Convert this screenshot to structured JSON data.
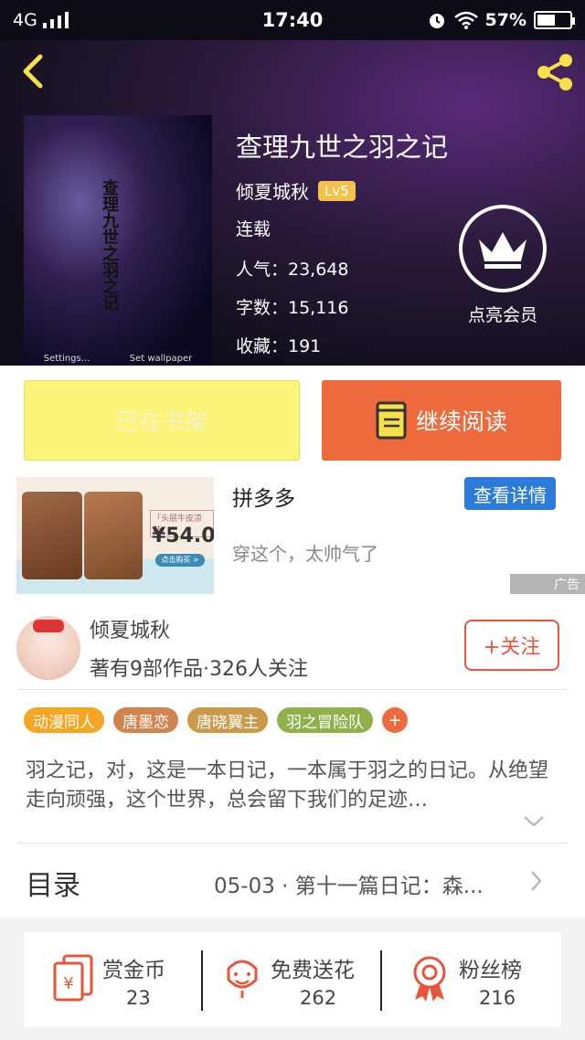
{
  "status_bar": {
    "network": "4G",
    "time": "17:40",
    "battery": "57%",
    "battery_level": 0.57
  },
  "book": {
    "title": "查理九世之羽之记",
    "author": "倾夏城秋",
    "level": "Lv5",
    "status": "连载",
    "popularity": "人气：23,648",
    "words": "字数：15,116",
    "favorites": "收藏：191",
    "cover": {
      "title_text": "查理九世之羽之记",
      "footer_left": "Settings...",
      "footer_right": "Set wallpaper"
    }
  },
  "vip": {
    "label": "点亮会员"
  },
  "actions": {
    "shelf_label": "已在书架",
    "read_label": "继续阅读"
  },
  "ad": {
    "title": "拼多多",
    "subtitle": "穿这个，太帅气了",
    "detail_label": "查看详情",
    "image_tag": "「头层牛皮凉鞋」",
    "image_price": "¥54.0",
    "image_buy": "点击购买 >",
    "mark": "广告"
  },
  "author_card": {
    "name": "倾夏城秋",
    "stats": "著有9部作品·326人关注",
    "follow_label": "+关注",
    "tags": [
      {
        "label": "动漫同人",
        "color": "#f5a623"
      },
      {
        "label": "唐墨恋",
        "color": "#d2844f"
      },
      {
        "label": "唐晓翼主",
        "color": "#c89a4a"
      },
      {
        "label": "羽之冒险队",
        "color": "#8fb04a"
      }
    ],
    "tag_more": "+",
    "summary": "羽之记，对，这是一本日记，一本属于羽之的日记。从绝望走向顽强，这个世界，总会留下我们的足迹…"
  },
  "toc": {
    "label": "目录",
    "latest": "05-03 · 第十一篇日记：森..."
  },
  "stats": [
    {
      "label": "赏金币",
      "count": "23",
      "icon": "coin-envelope-icon"
    },
    {
      "label": "免费送花",
      "count": "262",
      "icon": "flower-icon"
    },
    {
      "label": "粉丝榜",
      "count": "216",
      "icon": "ribbon-medal-icon"
    }
  ],
  "colors": {
    "accent": "#ee6a3c",
    "shelf": "#fbf479",
    "detail": "#2c7bd8",
    "follow": "#e8553a",
    "vip_badge": "#f6c14b"
  }
}
